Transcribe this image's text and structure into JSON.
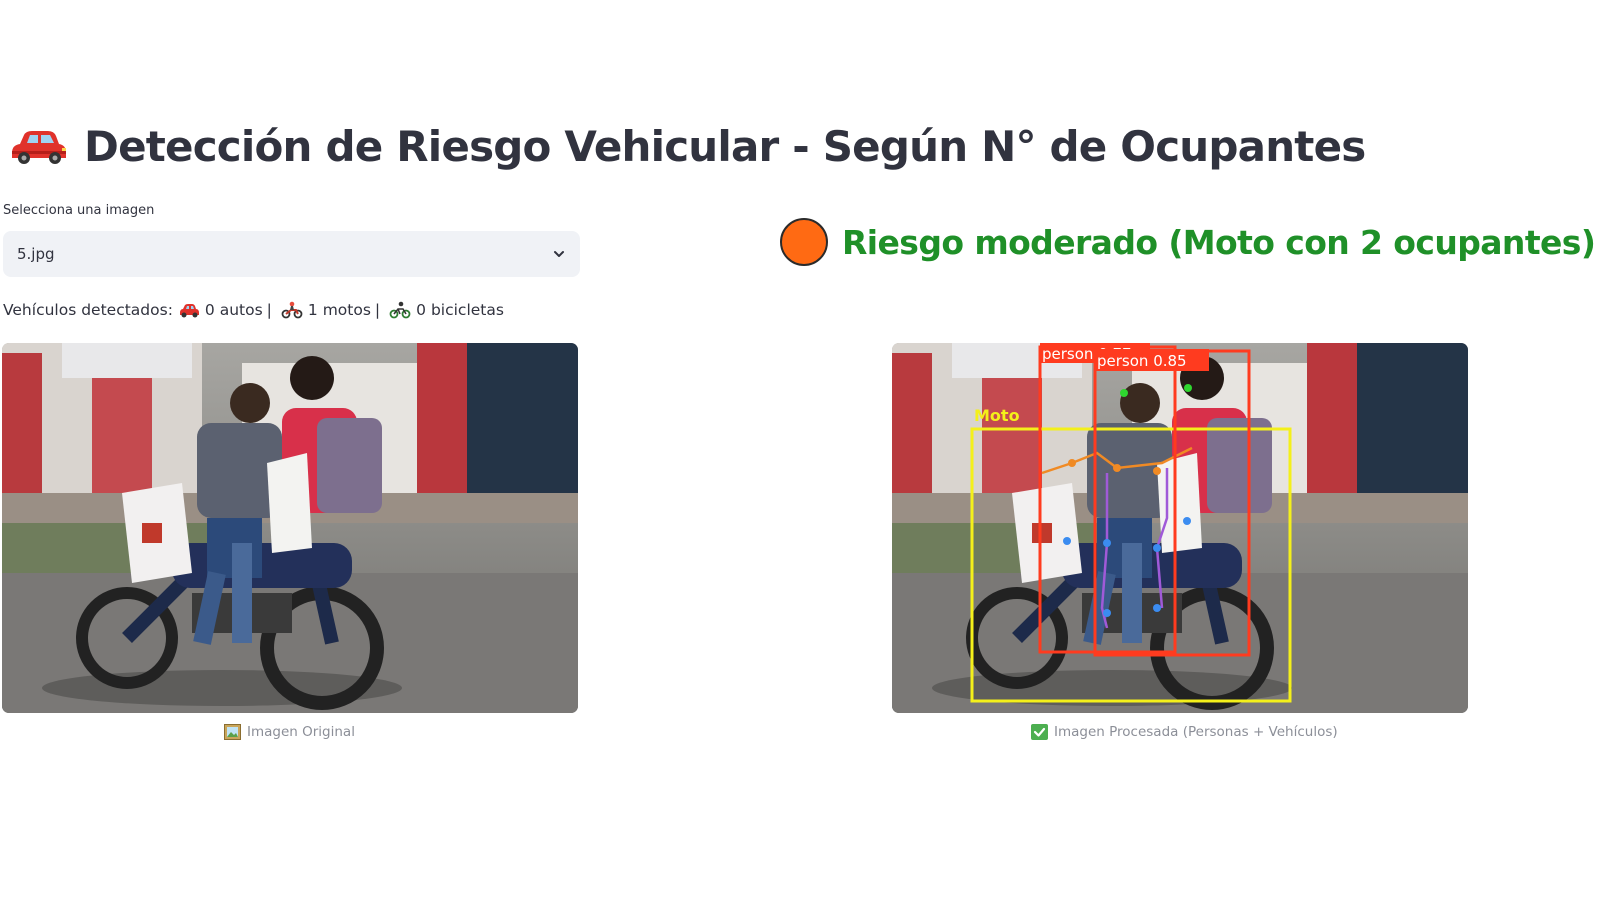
{
  "header": {
    "icon": "red-car-icon",
    "title": "Detección de Riesgo Vehicular - Según N° de Ocupantes"
  },
  "image_select": {
    "label": "Selecciona una imagen",
    "value": "5.jpg",
    "icon": "chevron-down-icon"
  },
  "vehicles": {
    "prefix": "Vehículos detectados:",
    "cars": "0 autos",
    "motos": "1 motos",
    "bikes": "0 bicicletas",
    "separator": "|",
    "icons": [
      "car-icon",
      "motorcycle-rider-icon",
      "bicycle-rider-icon"
    ]
  },
  "risk": {
    "indicator_color": "#ff6a13",
    "text_color": "#1f9028",
    "text": "Riesgo moderado (Moto con 2 ocupantes)"
  },
  "images": {
    "original_caption": "Imagen Original",
    "processed_caption": "Imagen Procesada (Personas + Vehículos)",
    "detections": [
      {
        "label": "person",
        "confidence": "0.77"
      },
      {
        "label": "person",
        "confidence": "0.85"
      },
      {
        "label": "Moto",
        "confidence": ""
      }
    ]
  },
  "colors": {
    "text": "#31333f",
    "select_bg": "#f0f2f6",
    "caption": "#8c8f98",
    "person_box": "#ff3b1f",
    "moto_box": "#f4f01a"
  }
}
